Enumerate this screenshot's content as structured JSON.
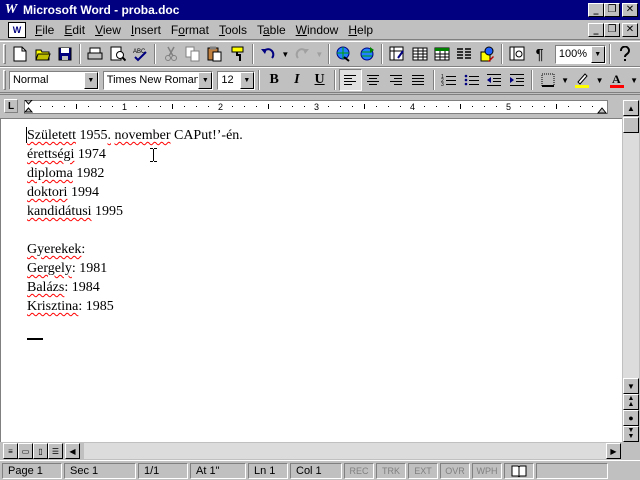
{
  "window": {
    "title": "Microsoft Word - proba.doc",
    "app_icon": "W"
  },
  "menu": {
    "items": [
      {
        "label": "File",
        "key": "F"
      },
      {
        "label": "Edit",
        "key": "E"
      },
      {
        "label": "View",
        "key": "V"
      },
      {
        "label": "Insert",
        "key": "I"
      },
      {
        "label": "Format",
        "key": "o"
      },
      {
        "label": "Tools",
        "key": "T"
      },
      {
        "label": "Table",
        "key": "a"
      },
      {
        "label": "Window",
        "key": "W"
      },
      {
        "label": "Help",
        "key": "H"
      }
    ]
  },
  "standard_toolbar": {
    "zoom": "100%",
    "icons": [
      "new-document-icon",
      "open-folder-icon",
      "save-icon",
      "print-icon",
      "print-preview-icon",
      "spelling-icon",
      "cut-icon",
      "copy-icon",
      "paste-icon",
      "format-painter-icon",
      "undo-icon",
      "redo-icon",
      "insert-hyperlink-icon",
      "web-toolbar-icon",
      "tables-borders-icon",
      "insert-table-icon",
      "insert-excel-icon",
      "columns-icon",
      "drawing-icon",
      "document-map-icon",
      "show-formatting-icon",
      "help-icon"
    ]
  },
  "formatting_toolbar": {
    "style": "Normal",
    "font": "Times New Roman",
    "size": "12",
    "bold": "B",
    "italic": "I",
    "underline": "U"
  },
  "ruler": {
    "numbers": [
      "1",
      "2",
      "3",
      "4",
      "5"
    ]
  },
  "document": {
    "lines": [
      [
        {
          "t": "Született",
          "sq": true
        },
        {
          "t": " 1955",
          "sq": false
        },
        {
          "t": ".",
          "sq": true
        },
        {
          "t": " ",
          "sq": false
        },
        {
          "t": "november",
          "sq": true
        },
        {
          "t": " CAPut!’-én.",
          "sq": false
        }
      ],
      [
        {
          "t": "érettségi",
          "sq": true
        },
        {
          "t": " 1974",
          "sq": false
        }
      ],
      [
        {
          "t": "diploma",
          "sq": true
        },
        {
          "t": " 1982",
          "sq": false
        }
      ],
      [
        {
          "t": "doktori",
          "sq": true
        },
        {
          "t": " 1994",
          "sq": false
        }
      ],
      [
        {
          "t": "kandidátusi",
          "sq": true
        },
        {
          "t": " 1995",
          "sq": false
        }
      ],
      [],
      [
        {
          "t": "Gyerekek",
          "sq": true
        },
        {
          "t": ":",
          "sq": false
        }
      ],
      [
        {
          "t": "Gergely",
          "sq": true
        },
        {
          "t": ": 1981",
          "sq": false
        }
      ],
      [
        {
          "t": "Balázs",
          "sq": true
        },
        {
          "t": ": 1984",
          "sq": false
        }
      ],
      [
        {
          "t": "Krisztina",
          "sq": true
        },
        {
          "t": ": 1985",
          "sq": false
        }
      ]
    ]
  },
  "status_bar": {
    "page": "Page 1",
    "sec": "Sec 1",
    "pages": "1/1",
    "at": "At 1\"",
    "ln": "Ln 1",
    "col": "Col 1",
    "rec": "REC",
    "trk": "TRK",
    "ext": "EXT",
    "ovr": "OVR",
    "wph": "WPH"
  }
}
